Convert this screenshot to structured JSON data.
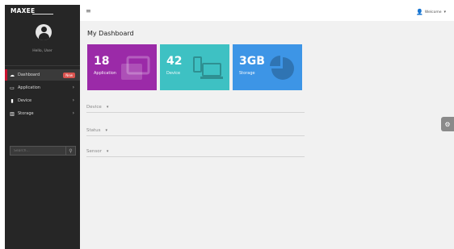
{
  "app": {
    "brand": "MAXEE"
  },
  "sidebar": {
    "user_caption": "Hello, User",
    "items": [
      {
        "label": "Dashboard",
        "icon": "dashboard-icon",
        "badge": "New",
        "active": true
      },
      {
        "label": "Application",
        "icon": "apps-icon",
        "chevron": "›"
      },
      {
        "label": "Device",
        "icon": "device-icon",
        "chevron": "›"
      },
      {
        "label": "Storage",
        "icon": "storage-icon",
        "chevron": "›"
      }
    ],
    "search": {
      "placeholder": "Search..."
    }
  },
  "header": {
    "menu_icon": "≡",
    "user_label": "Welcome",
    "user_caret": "▾"
  },
  "main": {
    "title": "My Dashboard",
    "tiles": [
      {
        "value": "18",
        "label": "Application",
        "color": "#9b2aa8"
      },
      {
        "value": "42",
        "label": "Device",
        "color": "#3ec1c3"
      },
      {
        "value": "3GB",
        "label": "Storage",
        "color": "#3d95e6"
      }
    ],
    "dropdowns": [
      {
        "label": "Device"
      },
      {
        "label": "Status"
      },
      {
        "label": "Sensor"
      }
    ]
  },
  "colors": {
    "sidebar_bg": "#262626",
    "accent_red": "#c8102e",
    "main_bg": "#f1f1f1"
  }
}
